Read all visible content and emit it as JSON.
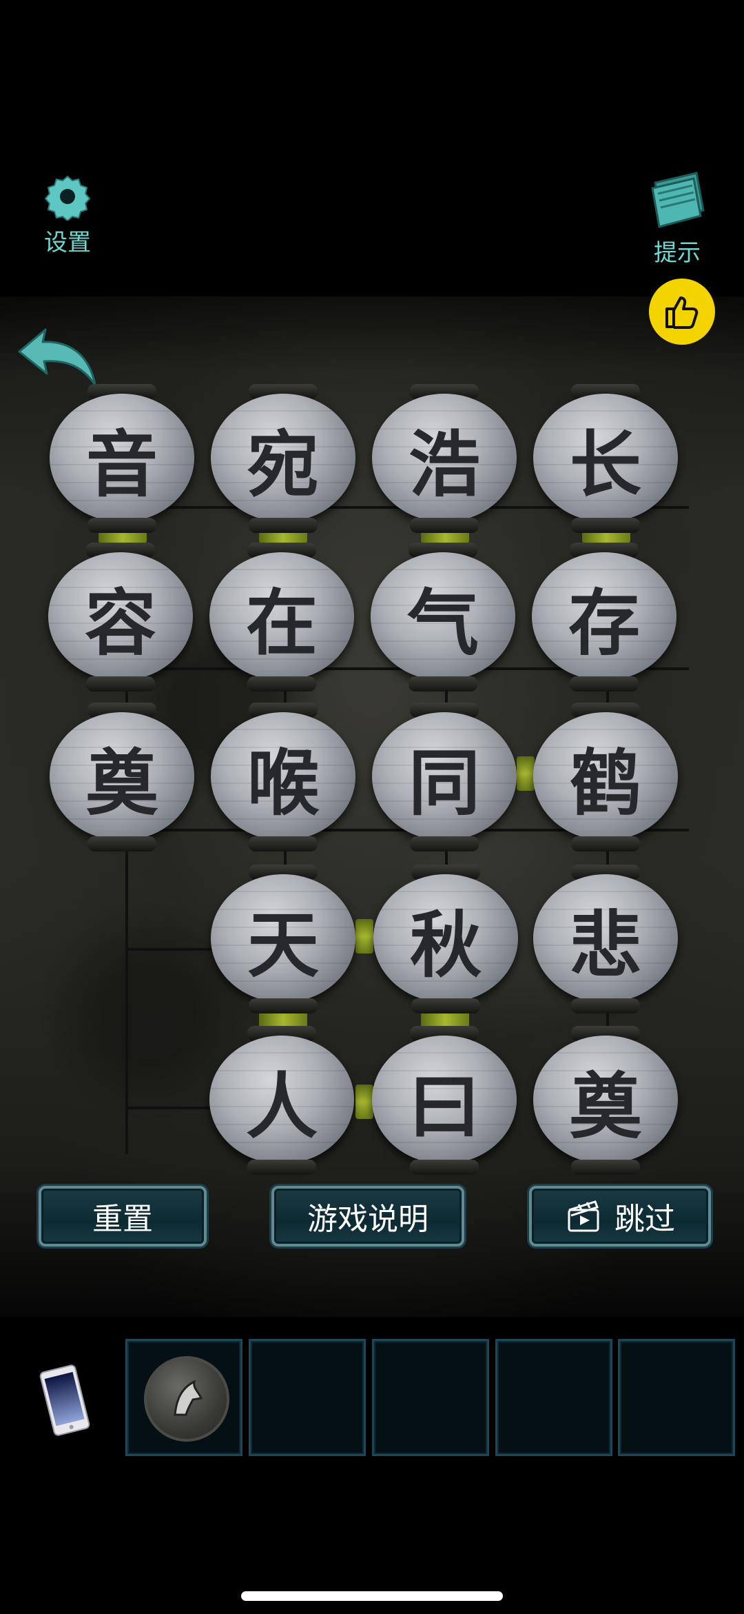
{
  "top_bar": {
    "settings_label": "设置",
    "hint_label": "提示",
    "settings_icon": "gear-icon",
    "hint_icon": "book-icon",
    "like_icon": "thumbs-up-icon",
    "back_icon": "back-arrow-icon"
  },
  "puzzle": {
    "rows": [
      [
        "音",
        "宛",
        "浩",
        "长"
      ],
      [
        "容",
        "在",
        "气",
        "存"
      ],
      [
        "奠",
        "喉",
        "同",
        "鹤"
      ],
      [
        "",
        "天",
        "秋",
        "悲"
      ],
      [
        "",
        "人",
        "曰",
        "奠"
      ]
    ]
  },
  "buttons": {
    "reset": "重置",
    "help": "游戏说明",
    "skip": "跳过",
    "skip_icon": "video-clapper-icon"
  },
  "inventory": {
    "phone_icon": "phone-icon",
    "slots": [
      "coin-item",
      "",
      "",
      "",
      ""
    ]
  },
  "colors": {
    "accent_teal": "#6fd6d0",
    "like_yellow": "#f3d400",
    "link_green": "#a8b830"
  }
}
